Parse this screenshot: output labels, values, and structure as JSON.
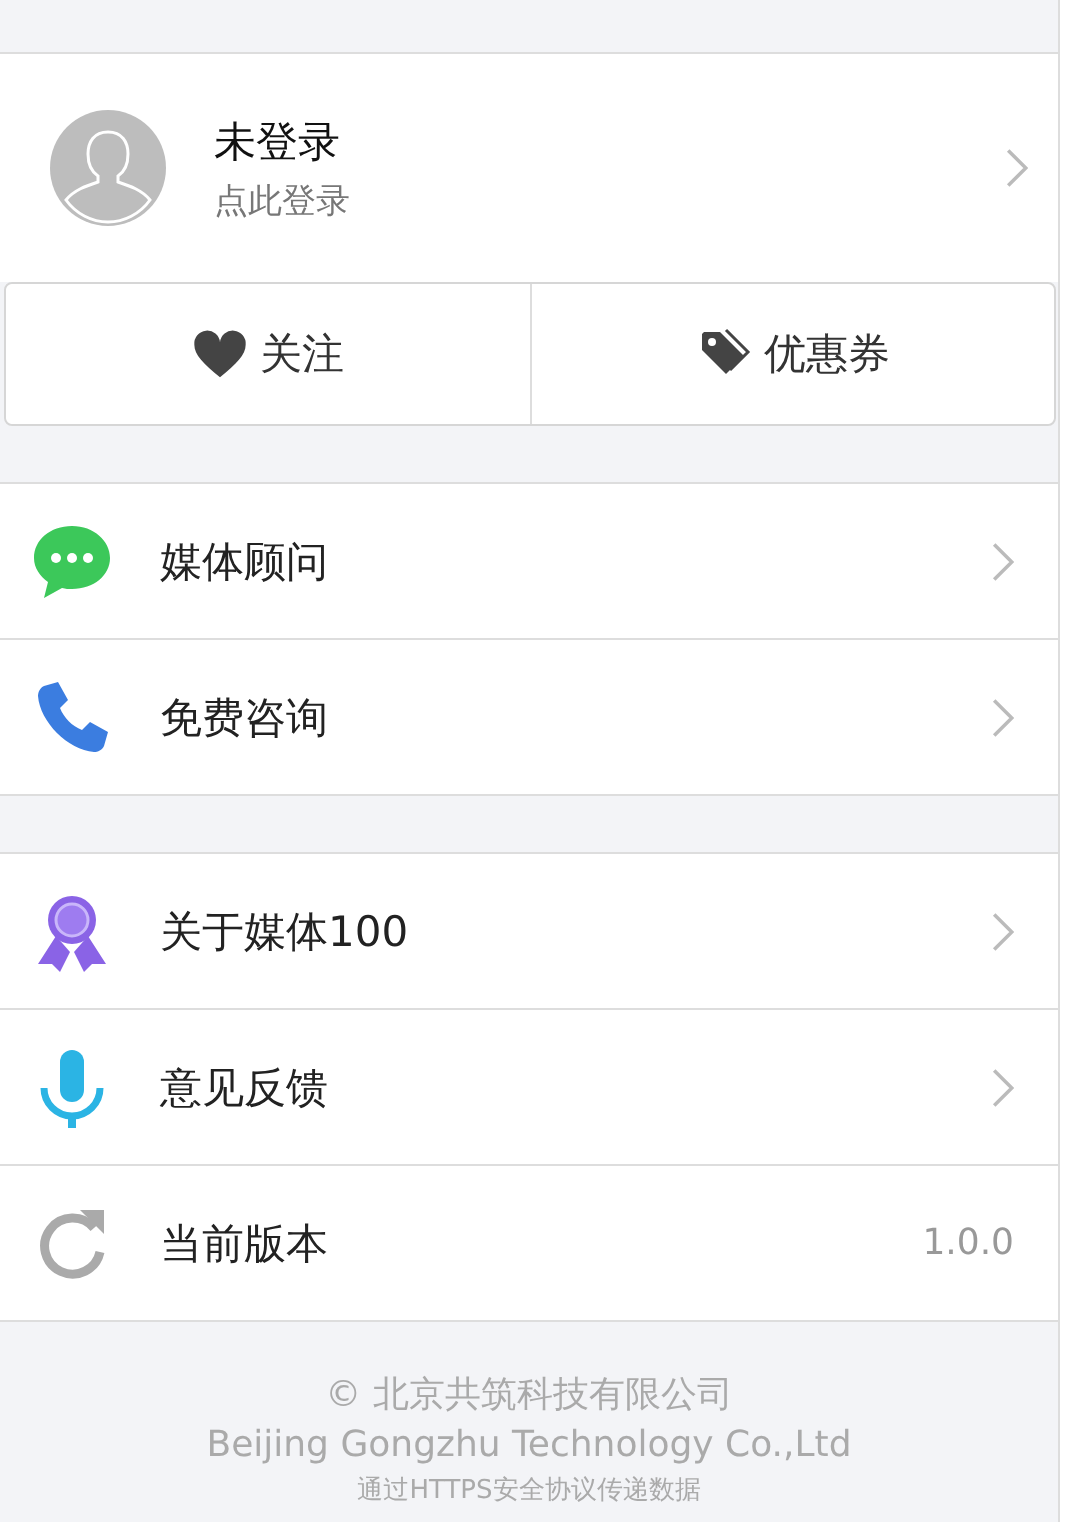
{
  "profile": {
    "name": "未登录",
    "hint": "点此登录"
  },
  "actions": [
    {
      "label": "关注"
    },
    {
      "label": "优惠券"
    }
  ],
  "sections": [
    {
      "items": [
        {
          "label": "媒体顾问",
          "kind": "link"
        },
        {
          "label": "免费咨询",
          "kind": "link"
        }
      ]
    },
    {
      "items": [
        {
          "label": "关于媒体100",
          "kind": "link"
        },
        {
          "label": "意见反馈",
          "kind": "link"
        },
        {
          "label": "当前版本",
          "kind": "value",
          "value": "1.0.0"
        }
      ]
    }
  ],
  "footer": {
    "copyright": "© 北京共筑科技有限公司",
    "company": "Beijing Gongzhu Technology Co.,Ltd",
    "note": "通过HTTPS安全协议传递数据"
  }
}
